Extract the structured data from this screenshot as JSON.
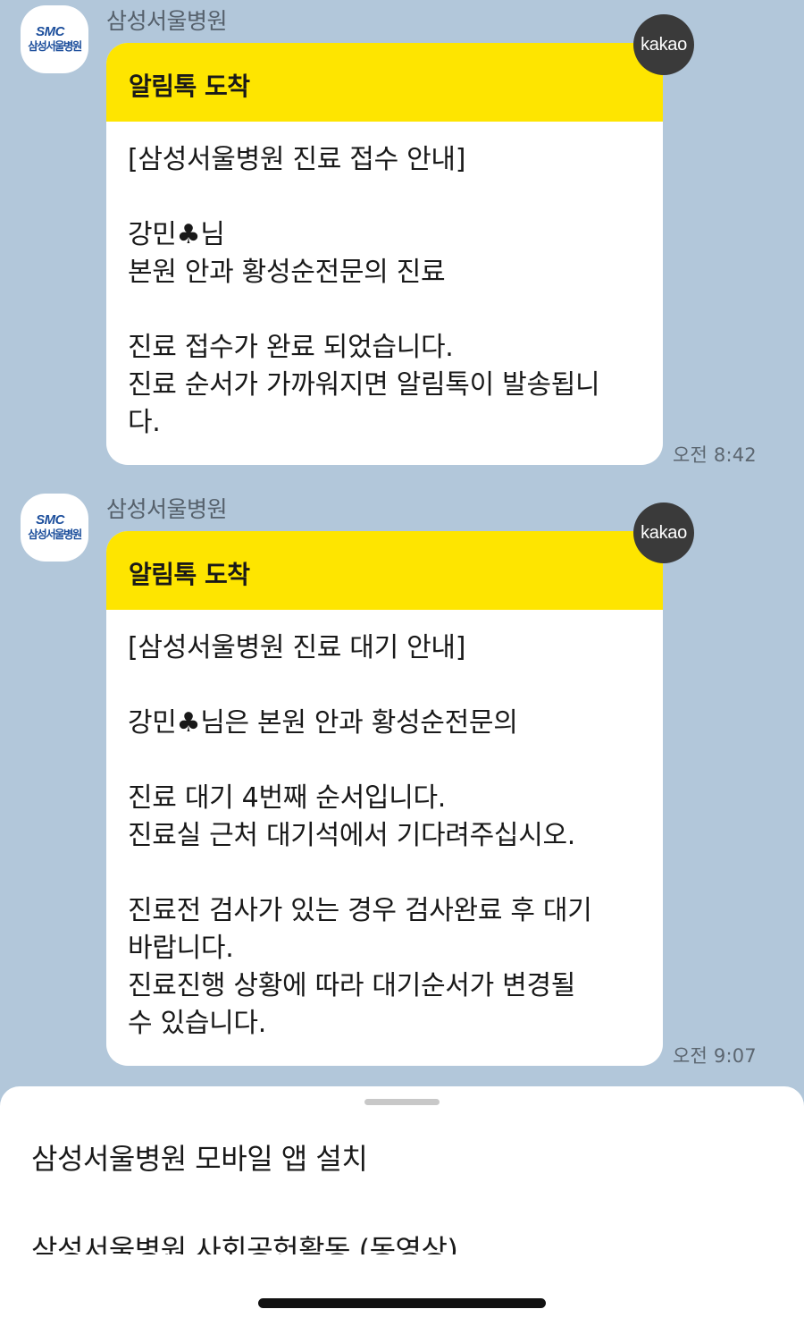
{
  "messages": [
    {
      "sender": "삼성서울병원",
      "avatar_logo": "SMC",
      "avatar_sub": "삼성서울병원",
      "badge": "kakao",
      "header": "알림톡 도착",
      "body": "[삼성서울병원 진료 접수 안내]\n\n강민♣님\n본원 안과 황성순전문의 진료\n\n진료 접수가 완료 되었습니다.\n진료 순서가 가까워지면 알림톡이 발송됩니\n다.",
      "time": "오전 8:42"
    },
    {
      "sender": "삼성서울병원",
      "avatar_logo": "SMC",
      "avatar_sub": "삼성서울병원",
      "badge": "kakao",
      "header": "알림톡 도착",
      "body": "[삼성서울병원 진료 대기 안내]\n\n강민♣님은 본원 안과 황성순전문의\n\n진료 대기 4번째 순서입니다.\n진료실 근처 대기석에서 기다려주십시오.\n\n진료전 검사가 있는 경우 검사완료 후 대기\n바랍니다.\n진료진행 상황에 따라 대기순서가 변경될\n수 있습니다.",
      "time": "오전 9:07"
    }
  ],
  "sheet": {
    "items": [
      "삼성서울병원 모바일 앱 설치",
      "삼성서울병원 사회공헌활동 (동영상)"
    ]
  },
  "colors": {
    "chat_background": "#b2c7da",
    "header_yellow": "#fee500",
    "badge_dark": "#3a3a3a",
    "logo_blue": "#1d4f9c"
  }
}
